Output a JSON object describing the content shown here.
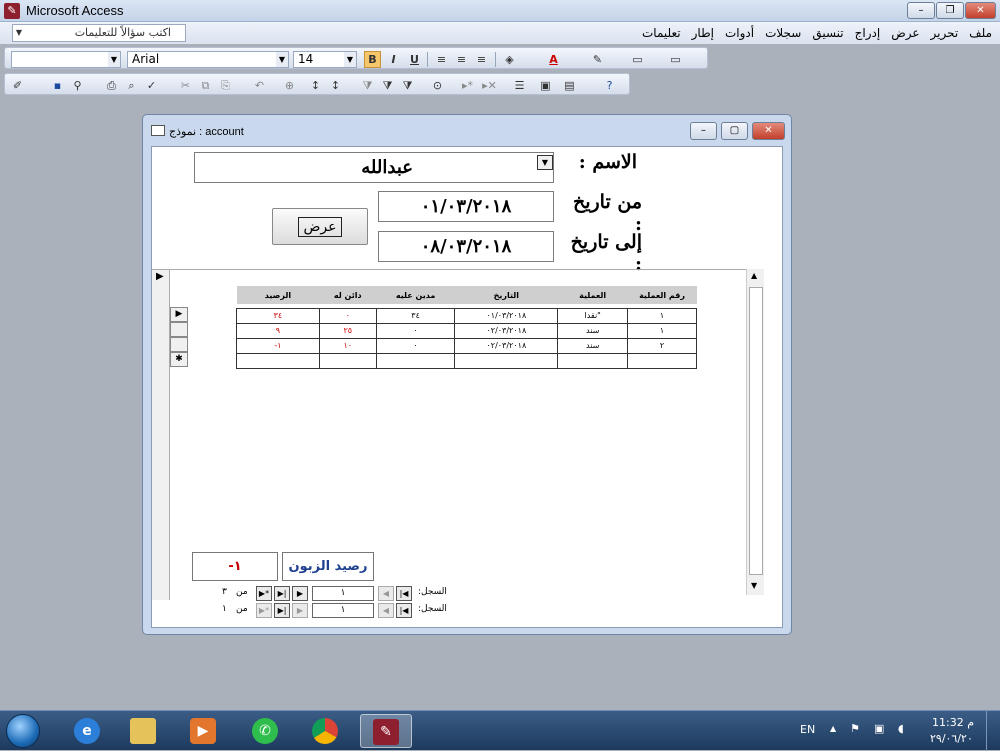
{
  "window": {
    "title": "Microsoft Access",
    "min": "–",
    "max": "❐",
    "close": "✕"
  },
  "menu": {
    "items": [
      "ملف",
      "تحرير",
      "عرض",
      "إدراج",
      "تنسيق",
      "سجلات",
      "أدوات",
      "إطار",
      "تعليمات"
    ],
    "help_placeholder": "اكتب سؤالاً للتعليمات"
  },
  "formatting": {
    "object_combo": "",
    "font": "Arial",
    "size": "14",
    "bold": "B",
    "italic": "I",
    "underline": "U"
  },
  "form": {
    "title": "نموذج : account",
    "name_label": "الاسم :",
    "name_value": "عبدالله",
    "from_label": "من تاريخ :",
    "from_value": "٠١/٠٣/٢٠١٨",
    "to_label": "إلى تاريخ :",
    "to_value": "٠٨/٠٣/٢٠١٨",
    "view_button": "عرض",
    "columns": [
      "الرصيد",
      "دائن له",
      "مدين عليه",
      "التاريخ",
      "العملية",
      "رقم العملية"
    ],
    "rows": [
      {
        "balance": "٣٤",
        "credit": "٠",
        "debit": "٣٤",
        "date": "٠١/٠٣/٢٠١٨",
        "op": "نقدا\"",
        "num": "١"
      },
      {
        "balance": "٩",
        "credit": "٢٥",
        "debit": "٠",
        "date": "٠٢/٠٣/٢٠١٨",
        "op": "سند",
        "num": "١"
      },
      {
        "balance": "-١",
        "credit": "١٠",
        "debit": "٠",
        "date": "٠٢/٠٣/٢٠١٨",
        "op": "سند",
        "num": "٢"
      }
    ],
    "customer_balance_label": "رصيد الزبون",
    "customer_balance_value": "-١",
    "subform_nav": {
      "label": "السجل:",
      "current": "١",
      "of": "من",
      "total": "٣"
    },
    "main_nav": {
      "label": "السجل:",
      "current": "١",
      "of": "من",
      "total": "١"
    }
  },
  "taskbar": {
    "lang": "EN",
    "time": "11:32 م",
    "date": "٢٩/٠٦/٢٠"
  },
  "colors": {
    "negative": "#cc0000",
    "label_blue": "#1f3f8f",
    "bold_active": "#f6c66b"
  }
}
